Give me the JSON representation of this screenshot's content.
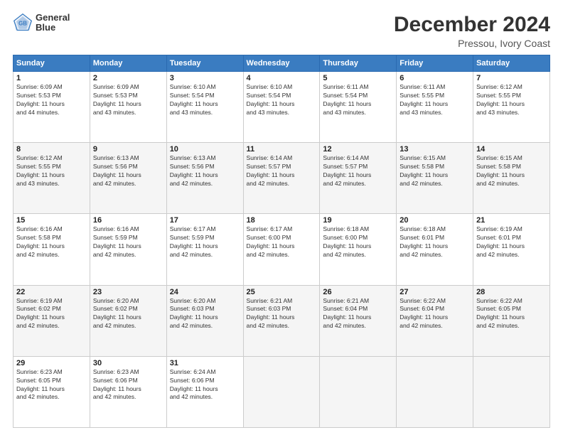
{
  "header": {
    "logo_line1": "General",
    "logo_line2": "Blue",
    "main_title": "December 2024",
    "subtitle": "Pressou, Ivory Coast"
  },
  "calendar": {
    "days_of_week": [
      "Sunday",
      "Monday",
      "Tuesday",
      "Wednesday",
      "Thursday",
      "Friday",
      "Saturday"
    ],
    "weeks": [
      [
        {
          "day": "",
          "info": ""
        },
        {
          "day": "2",
          "info": "Sunrise: 6:09 AM\nSunset: 5:53 PM\nDaylight: 11 hours\nand 43 minutes."
        },
        {
          "day": "3",
          "info": "Sunrise: 6:10 AM\nSunset: 5:54 PM\nDaylight: 11 hours\nand 43 minutes."
        },
        {
          "day": "4",
          "info": "Sunrise: 6:10 AM\nSunset: 5:54 PM\nDaylight: 11 hours\nand 43 minutes."
        },
        {
          "day": "5",
          "info": "Sunrise: 6:11 AM\nSunset: 5:54 PM\nDaylight: 11 hours\nand 43 minutes."
        },
        {
          "day": "6",
          "info": "Sunrise: 6:11 AM\nSunset: 5:55 PM\nDaylight: 11 hours\nand 43 minutes."
        },
        {
          "day": "7",
          "info": "Sunrise: 6:12 AM\nSunset: 5:55 PM\nDaylight: 11 hours\nand 43 minutes."
        }
      ],
      [
        {
          "day": "1",
          "info": "Sunrise: 6:09 AM\nSunset: 5:53 PM\nDaylight: 11 hours\nand 44 minutes.",
          "first_col": true
        },
        {
          "day": "9",
          "info": "Sunrise: 6:13 AM\nSunset: 5:56 PM\nDaylight: 11 hours\nand 42 minutes."
        },
        {
          "day": "10",
          "info": "Sunrise: 6:13 AM\nSunset: 5:56 PM\nDaylight: 11 hours\nand 42 minutes."
        },
        {
          "day": "11",
          "info": "Sunrise: 6:14 AM\nSunset: 5:57 PM\nDaylight: 11 hours\nand 42 minutes."
        },
        {
          "day": "12",
          "info": "Sunrise: 6:14 AM\nSunset: 5:57 PM\nDaylight: 11 hours\nand 42 minutes."
        },
        {
          "day": "13",
          "info": "Sunrise: 6:15 AM\nSunset: 5:58 PM\nDaylight: 11 hours\nand 42 minutes."
        },
        {
          "day": "14",
          "info": "Sunrise: 6:15 AM\nSunset: 5:58 PM\nDaylight: 11 hours\nand 42 minutes."
        }
      ],
      [
        {
          "day": "8",
          "info": "Sunrise: 6:12 AM\nSunset: 5:55 PM\nDaylight: 11 hours\nand 43 minutes.",
          "first_col": true
        },
        {
          "day": "16",
          "info": "Sunrise: 6:16 AM\nSunset: 5:59 PM\nDaylight: 11 hours\nand 42 minutes."
        },
        {
          "day": "17",
          "info": "Sunrise: 6:17 AM\nSunset: 5:59 PM\nDaylight: 11 hours\nand 42 minutes."
        },
        {
          "day": "18",
          "info": "Sunrise: 6:17 AM\nSunset: 6:00 PM\nDaylight: 11 hours\nand 42 minutes."
        },
        {
          "day": "19",
          "info": "Sunrise: 6:18 AM\nSunset: 6:00 PM\nDaylight: 11 hours\nand 42 minutes."
        },
        {
          "day": "20",
          "info": "Sunrise: 6:18 AM\nSunset: 6:01 PM\nDaylight: 11 hours\nand 42 minutes."
        },
        {
          "day": "21",
          "info": "Sunrise: 6:19 AM\nSunset: 6:01 PM\nDaylight: 11 hours\nand 42 minutes."
        }
      ],
      [
        {
          "day": "15",
          "info": "Sunrise: 6:16 AM\nSunset: 5:58 PM\nDaylight: 11 hours\nand 42 minutes.",
          "first_col": true
        },
        {
          "day": "23",
          "info": "Sunrise: 6:20 AM\nSunset: 6:02 PM\nDaylight: 11 hours\nand 42 minutes."
        },
        {
          "day": "24",
          "info": "Sunrise: 6:20 AM\nSunset: 6:03 PM\nDaylight: 11 hours\nand 42 minutes."
        },
        {
          "day": "25",
          "info": "Sunrise: 6:21 AM\nSunset: 6:03 PM\nDaylight: 11 hours\nand 42 minutes."
        },
        {
          "day": "26",
          "info": "Sunrise: 6:21 AM\nSunset: 6:04 PM\nDaylight: 11 hours\nand 42 minutes."
        },
        {
          "day": "27",
          "info": "Sunrise: 6:22 AM\nSunset: 6:04 PM\nDaylight: 11 hours\nand 42 minutes."
        },
        {
          "day": "28",
          "info": "Sunrise: 6:22 AM\nSunset: 6:05 PM\nDaylight: 11 hours\nand 42 minutes."
        }
      ],
      [
        {
          "day": "22",
          "info": "Sunrise: 6:19 AM\nSunset: 6:02 PM\nDaylight: 11 hours\nand 42 minutes.",
          "first_col": true
        },
        {
          "day": "30",
          "info": "Sunrise: 6:23 AM\nSunset: 6:06 PM\nDaylight: 11 hours\nand 42 minutes."
        },
        {
          "day": "31",
          "info": "Sunrise: 6:24 AM\nSunset: 6:06 PM\nDaylight: 11 hours\nand 42 minutes."
        },
        {
          "day": "",
          "info": ""
        },
        {
          "day": "",
          "info": ""
        },
        {
          "day": "",
          "info": ""
        },
        {
          "day": "",
          "info": ""
        }
      ],
      [
        {
          "day": "29",
          "info": "Sunrise: 6:23 AM\nSunset: 6:05 PM\nDaylight: 11 hours\nand 42 minutes.",
          "first_col": true
        },
        {
          "day": "",
          "info": ""
        },
        {
          "day": "",
          "info": ""
        },
        {
          "day": "",
          "info": ""
        },
        {
          "day": "",
          "info": ""
        },
        {
          "day": "",
          "info": ""
        },
        {
          "day": "",
          "info": ""
        }
      ]
    ]
  }
}
